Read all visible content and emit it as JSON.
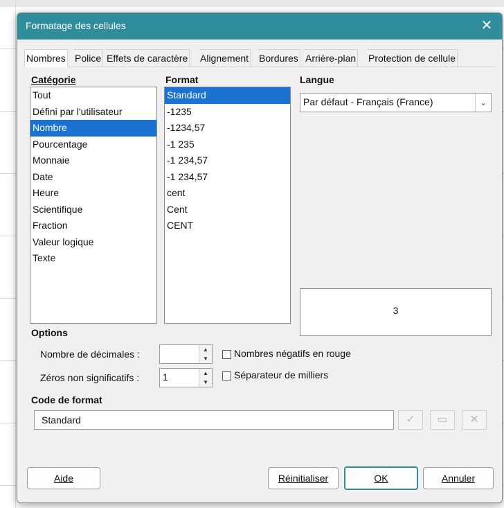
{
  "dialog": {
    "title": "Formatage des cellules",
    "close_symbol": "✕"
  },
  "tabs": [
    {
      "label": "Nombres"
    },
    {
      "label": "Police"
    },
    {
      "label": "Effets de caractère"
    },
    {
      "label": "Alignement"
    },
    {
      "label": "Bordures"
    },
    {
      "label": "Arrière-plan"
    },
    {
      "label": "Protection de cellule"
    }
  ],
  "active_tab": "Nombres",
  "category": {
    "heading": "Catégorie",
    "items": [
      "Tout",
      "Défini par l'utilisateur",
      "Nombre",
      "Pourcentage",
      "Monnaie",
      "Date",
      "Heure",
      "Scientifique",
      "Fraction",
      "Valeur logique",
      "Texte"
    ],
    "selected": "Nombre"
  },
  "format": {
    "heading": "Format",
    "items": [
      "Standard",
      "-1235",
      "-1234,57",
      "-1 235",
      "-1 234,57",
      "-1 234,57",
      "cent",
      "Cent",
      "CENT"
    ],
    "selected": "Standard"
  },
  "language": {
    "heading": "Langue",
    "value": "Par défaut - Français (France)",
    "arrow": "⌄"
  },
  "preview": {
    "value": "3"
  },
  "options": {
    "heading": "Options",
    "decimals_label": "Nombre de décimales :",
    "decimals_value": "",
    "leading_zeros_label": "Zéros non significatifs :",
    "leading_zeros_value": "1",
    "negative_red_label": "Nombres négatifs en rouge",
    "negative_red_checked": false,
    "thousands_sep_label": "Séparateur de milliers",
    "thousands_sep_checked": false
  },
  "format_code": {
    "heading": "Code de format",
    "value": "Standard",
    "accept_symbol": "✓",
    "comment_symbol": "▭",
    "delete_symbol": "✕"
  },
  "buttons": {
    "help": "Aide",
    "reset": "Réinitialiser",
    "ok": "OK",
    "cancel": "Annuler"
  },
  "colors": {
    "titlebar": "#2f8d9c",
    "selection": "#1a73d0"
  }
}
